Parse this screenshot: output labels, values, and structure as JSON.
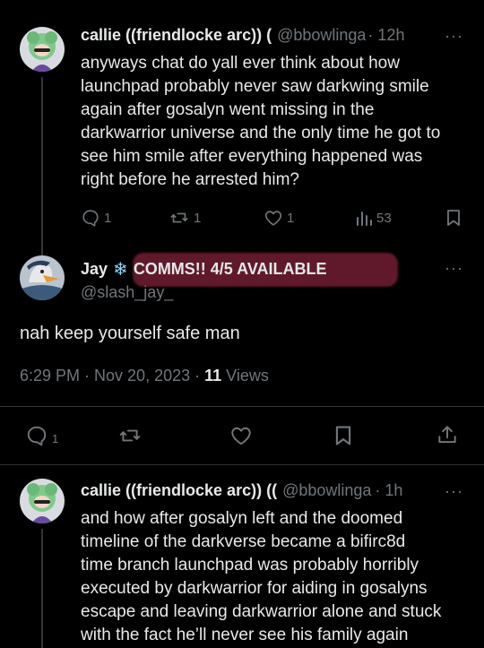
{
  "tweet1": {
    "author_name": "callie ((friendlocke arc)) (",
    "handle": "@bbowlinga",
    "time": "· 12h",
    "lines": [
      "anyways chat do yall ever think about how",
      "launchpad probably never saw darkwing smile",
      "again after gosalyn went missing in the",
      "darkwarrior universe and the only time he got to",
      "see him smile after everything happened was",
      "right before he arrested him?"
    ],
    "replies": "1",
    "retweets": "1",
    "likes": "1",
    "views": "53"
  },
  "tweet2": {
    "author_name": "Jay",
    "name_badge": "❄",
    "name_extra": "COMMS!! 4/5 AVAILABLE",
    "handle": "@slash_jay_",
    "text": "nah keep yourself safe man",
    "timestamp": "6:29 PM · Nov 20, 2023 · ",
    "views_count": "11",
    "views_label": " Views",
    "replies": "1"
  },
  "tweet3": {
    "author_name": "callie ((friendlocke arc)) ((",
    "handle": "@bbowlinga",
    "time": "· 1h",
    "lines": [
      "and how after gosalyn left and the doomed",
      "timeline of the darkverse became a bifirc8d",
      "time branch launchpad was probably horribly",
      "executed by darkwarrior for aiding in gosalyns",
      "escape and leaving darkwarrior alone and stuck",
      "with the fact he’ll never see his family again"
    ]
  },
  "colors": {
    "background": "#000000",
    "text": "#e7e9ea",
    "secondary": "#71767b",
    "highlight": "#7a2136"
  }
}
